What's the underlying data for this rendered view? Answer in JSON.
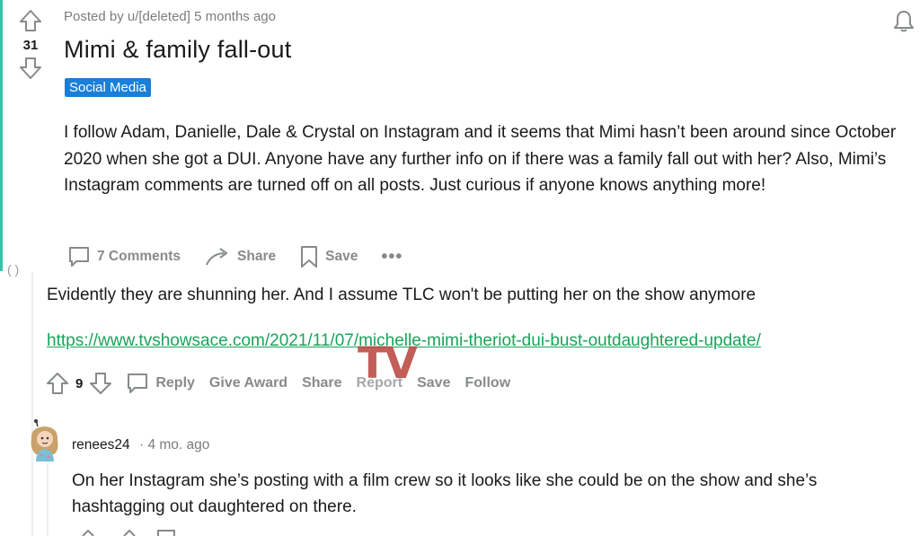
{
  "post": {
    "meta": "Posted by u/[deleted] 5 months ago",
    "score": "31",
    "title": "Mimi & family fall-out",
    "flair": "Social Media",
    "body": "I follow Adam, Danielle, Dale & Crystal on Instagram and it seems that Mimi hasn’t been around since October 2020 when she got a DUI. Anyone have any further info on if there was a family fall out with her? Also, Mimi’s Instagram comments are turned off on all posts. Just curious if anyone knows anything more!",
    "actions": {
      "comments_label": "7 Comments",
      "share_label": "Share",
      "save_label": "Save",
      "more_label": "•••"
    }
  },
  "comment1": {
    "text": "Evidently they are shunning her. And I assume TLC won't be putting her on the show anymore",
    "link": "https://www.tvshowsace.com/2021/11/07/michelle-mimi-theriot-dui-bust-outdaughtered-update/",
    "score": "9",
    "actions": {
      "reply": "Reply",
      "give_award": "Give Award",
      "share": "Share",
      "report": "Report",
      "save": "Save",
      "follow": "Follow"
    }
  },
  "watermark": "TV",
  "comment2": {
    "author": "renees24",
    "time": "· 4 mo. ago",
    "text": "On her Instagram she’s posting with a film crew so it looks like she could be on the show and she’s hashtagging out daughtered on there."
  },
  "colors": {
    "accent_bar": "#33c4a8",
    "flair_bg": "#1a7fd6",
    "link": "#1aa35a",
    "watermark": "#b8413a",
    "muted": "#878a8c"
  }
}
